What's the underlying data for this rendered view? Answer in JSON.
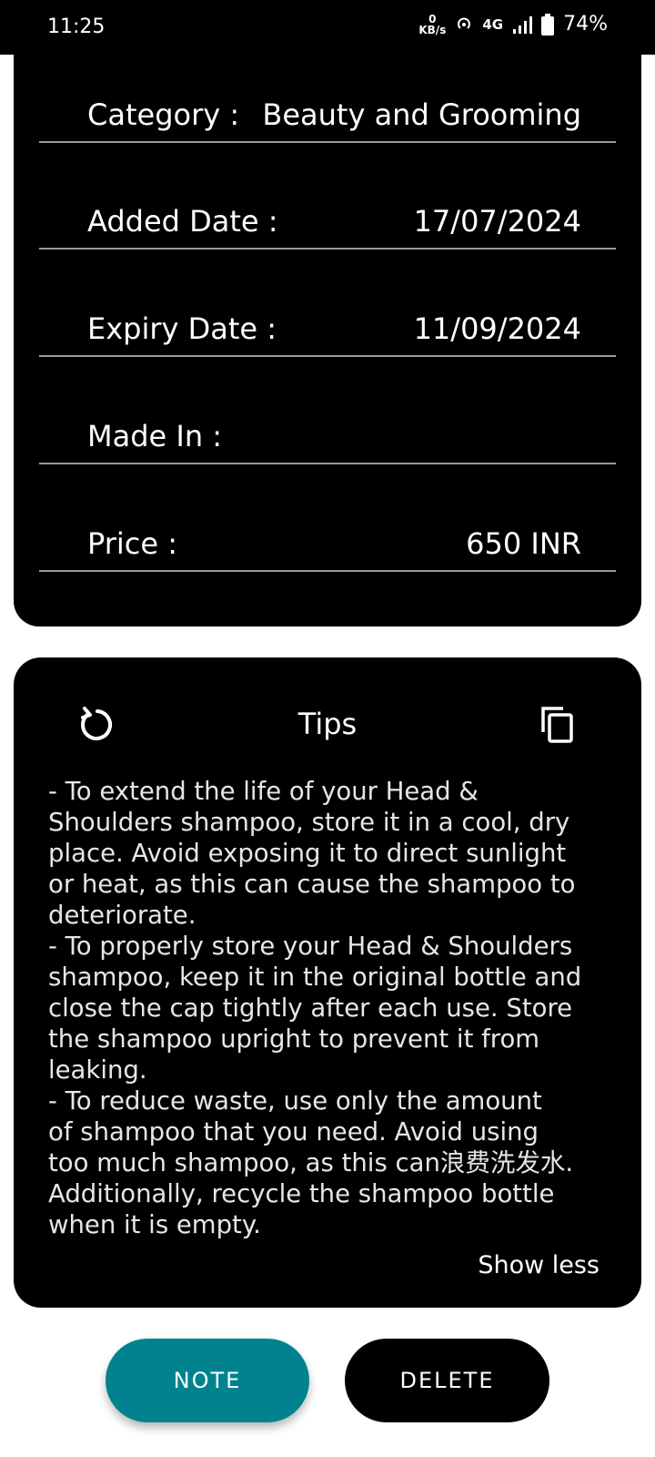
{
  "status_bar": {
    "time": "11:25",
    "net_speed_value": "0",
    "net_speed_unit": "KB/s",
    "network_type": "4G",
    "battery_percent": "74%"
  },
  "details": [
    {
      "label": "Category :",
      "value": "Beauty and Grooming"
    },
    {
      "label": "Added Date :",
      "value": "17/07/2024"
    },
    {
      "label": "Expiry Date :",
      "value": "11/09/2024"
    },
    {
      "label": "Made In :",
      "value": ""
    },
    {
      "label": "Price :",
      "value": "650 INR"
    }
  ],
  "tips": {
    "title": "Tips",
    "lines": [
      "- To extend the life of your Head &",
      "Shoulders shampoo, store it in a cool, dry",
      "place. Avoid exposing it to direct sunlight",
      "or heat, as this can cause the shampoo to",
      "deteriorate.",
      "- To properly store your Head & Shoulders",
      "shampoo, keep it in the original bottle and",
      "close the cap tightly after each use. Store",
      "the shampoo upright to prevent it from",
      "leaking.",
      "- To reduce waste, use only the amount",
      "of shampoo that you need. Avoid using",
      "too much shampoo, as this can浪费洗发水.",
      "Additionally, recycle the shampoo bottle",
      "when it is empty."
    ],
    "show_less": "Show less",
    "icons": {
      "refresh": "refresh-icon",
      "copy": "copy-icon"
    }
  },
  "buttons": {
    "note": "NOTE",
    "delete": "DELETE"
  },
  "colors": {
    "card_bg": "#000000",
    "page_bg": "#ffffff",
    "note_button": "#00838f",
    "divider": "#9a9a9a"
  }
}
